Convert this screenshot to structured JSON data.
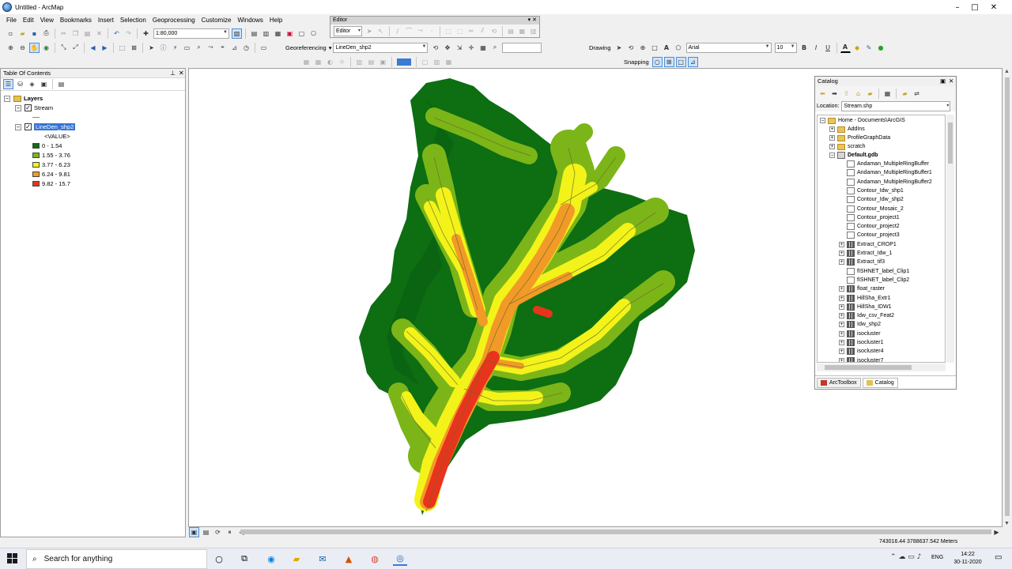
{
  "window": {
    "title": "Untitled - ArcMap",
    "minimize": "–",
    "maximize": "□",
    "close": "✕"
  },
  "menu": [
    "File",
    "Edit",
    "View",
    "Bookmarks",
    "Insert",
    "Selection",
    "Geoprocessing",
    "Customize",
    "Windows",
    "Help"
  ],
  "toolbar": {
    "scale": "1:80,000",
    "georeferencing_label": "Georeferencing",
    "georef_layer": "LineDen_shp2",
    "drawing_label": "Drawing",
    "font": "Arial",
    "font_size": "10",
    "snapping_label": "Snapping",
    "bold": "B",
    "italic": "I",
    "underline": "U"
  },
  "editor": {
    "title": "Editor",
    "menu_label": "Editor"
  },
  "toc": {
    "title": "Table Of Contents",
    "root": "Layers",
    "layers": [
      {
        "name": "Stream",
        "checked": true
      },
      {
        "name": "LineDen_shp2",
        "checked": true,
        "field": "<VALUE>"
      }
    ],
    "legend": [
      {
        "label": "0 - 1.54",
        "color": "#0d6e12"
      },
      {
        "label": "1.55 - 3.76",
        "color": "#7cb518"
      },
      {
        "label": "3.77 - 6.23",
        "color": "#f3f31a"
      },
      {
        "label": "6.24 - 9.81",
        "color": "#f29a27"
      },
      {
        "label": "9.82 - 15.7",
        "color": "#e8341c"
      }
    ]
  },
  "catalog": {
    "title": "Catalog",
    "location_label": "Location:",
    "location_value": "Stream.shp",
    "root": "Home - Documents\\ArcGIS",
    "folders": [
      "AddIns",
      "ProfileGraphData",
      "scratch"
    ],
    "gdb": "Default.gdb",
    "items": [
      {
        "name": "Andaman_MultipleRingBuffer",
        "kind": "fc"
      },
      {
        "name": "Andaman_MultipleRingBuffer1",
        "kind": "fc"
      },
      {
        "name": "Andaman_MultipleRingBuffer2",
        "kind": "fc"
      },
      {
        "name": "Contour_Idw_shp1",
        "kind": "fc"
      },
      {
        "name": "Contour_Idw_shp2",
        "kind": "fc"
      },
      {
        "name": "Contour_Mosaic_2",
        "kind": "fc"
      },
      {
        "name": "Contour_project1",
        "kind": "fc"
      },
      {
        "name": "Contour_project2",
        "kind": "fc"
      },
      {
        "name": "Contour_project3",
        "kind": "fc"
      },
      {
        "name": "Extract_CROP1",
        "kind": "raster"
      },
      {
        "name": "Extract_Idw_1",
        "kind": "raster"
      },
      {
        "name": "Extract_tif3",
        "kind": "raster"
      },
      {
        "name": "fISHNET_label_Clip1",
        "kind": "fc"
      },
      {
        "name": "fISHNET_label_Clip2",
        "kind": "fc"
      },
      {
        "name": "float_raster",
        "kind": "raster"
      },
      {
        "name": "HillSha_Extr1",
        "kind": "raster"
      },
      {
        "name": "HillSha_IDW1",
        "kind": "raster"
      },
      {
        "name": "Idw_csv_Feat2",
        "kind": "raster"
      },
      {
        "name": "Idw_shp2",
        "kind": "raster"
      },
      {
        "name": "isocluster",
        "kind": "raster"
      },
      {
        "name": "isocluster1",
        "kind": "raster"
      },
      {
        "name": "isocluster4",
        "kind": "raster"
      },
      {
        "name": "isocluster7",
        "kind": "raster"
      }
    ],
    "tabs": [
      "ArcToolbox",
      "Catalog"
    ]
  },
  "status": {
    "coordinates": "743016.44  3788637.542 Meters"
  },
  "taskbar": {
    "search_placeholder": "Search for anything",
    "language": "ENG",
    "time": "14:22",
    "date": "30-11-2020"
  },
  "icons": {
    "arcmap": "globe-icon",
    "search": "search-icon",
    "windows": "windows-start-icon"
  }
}
